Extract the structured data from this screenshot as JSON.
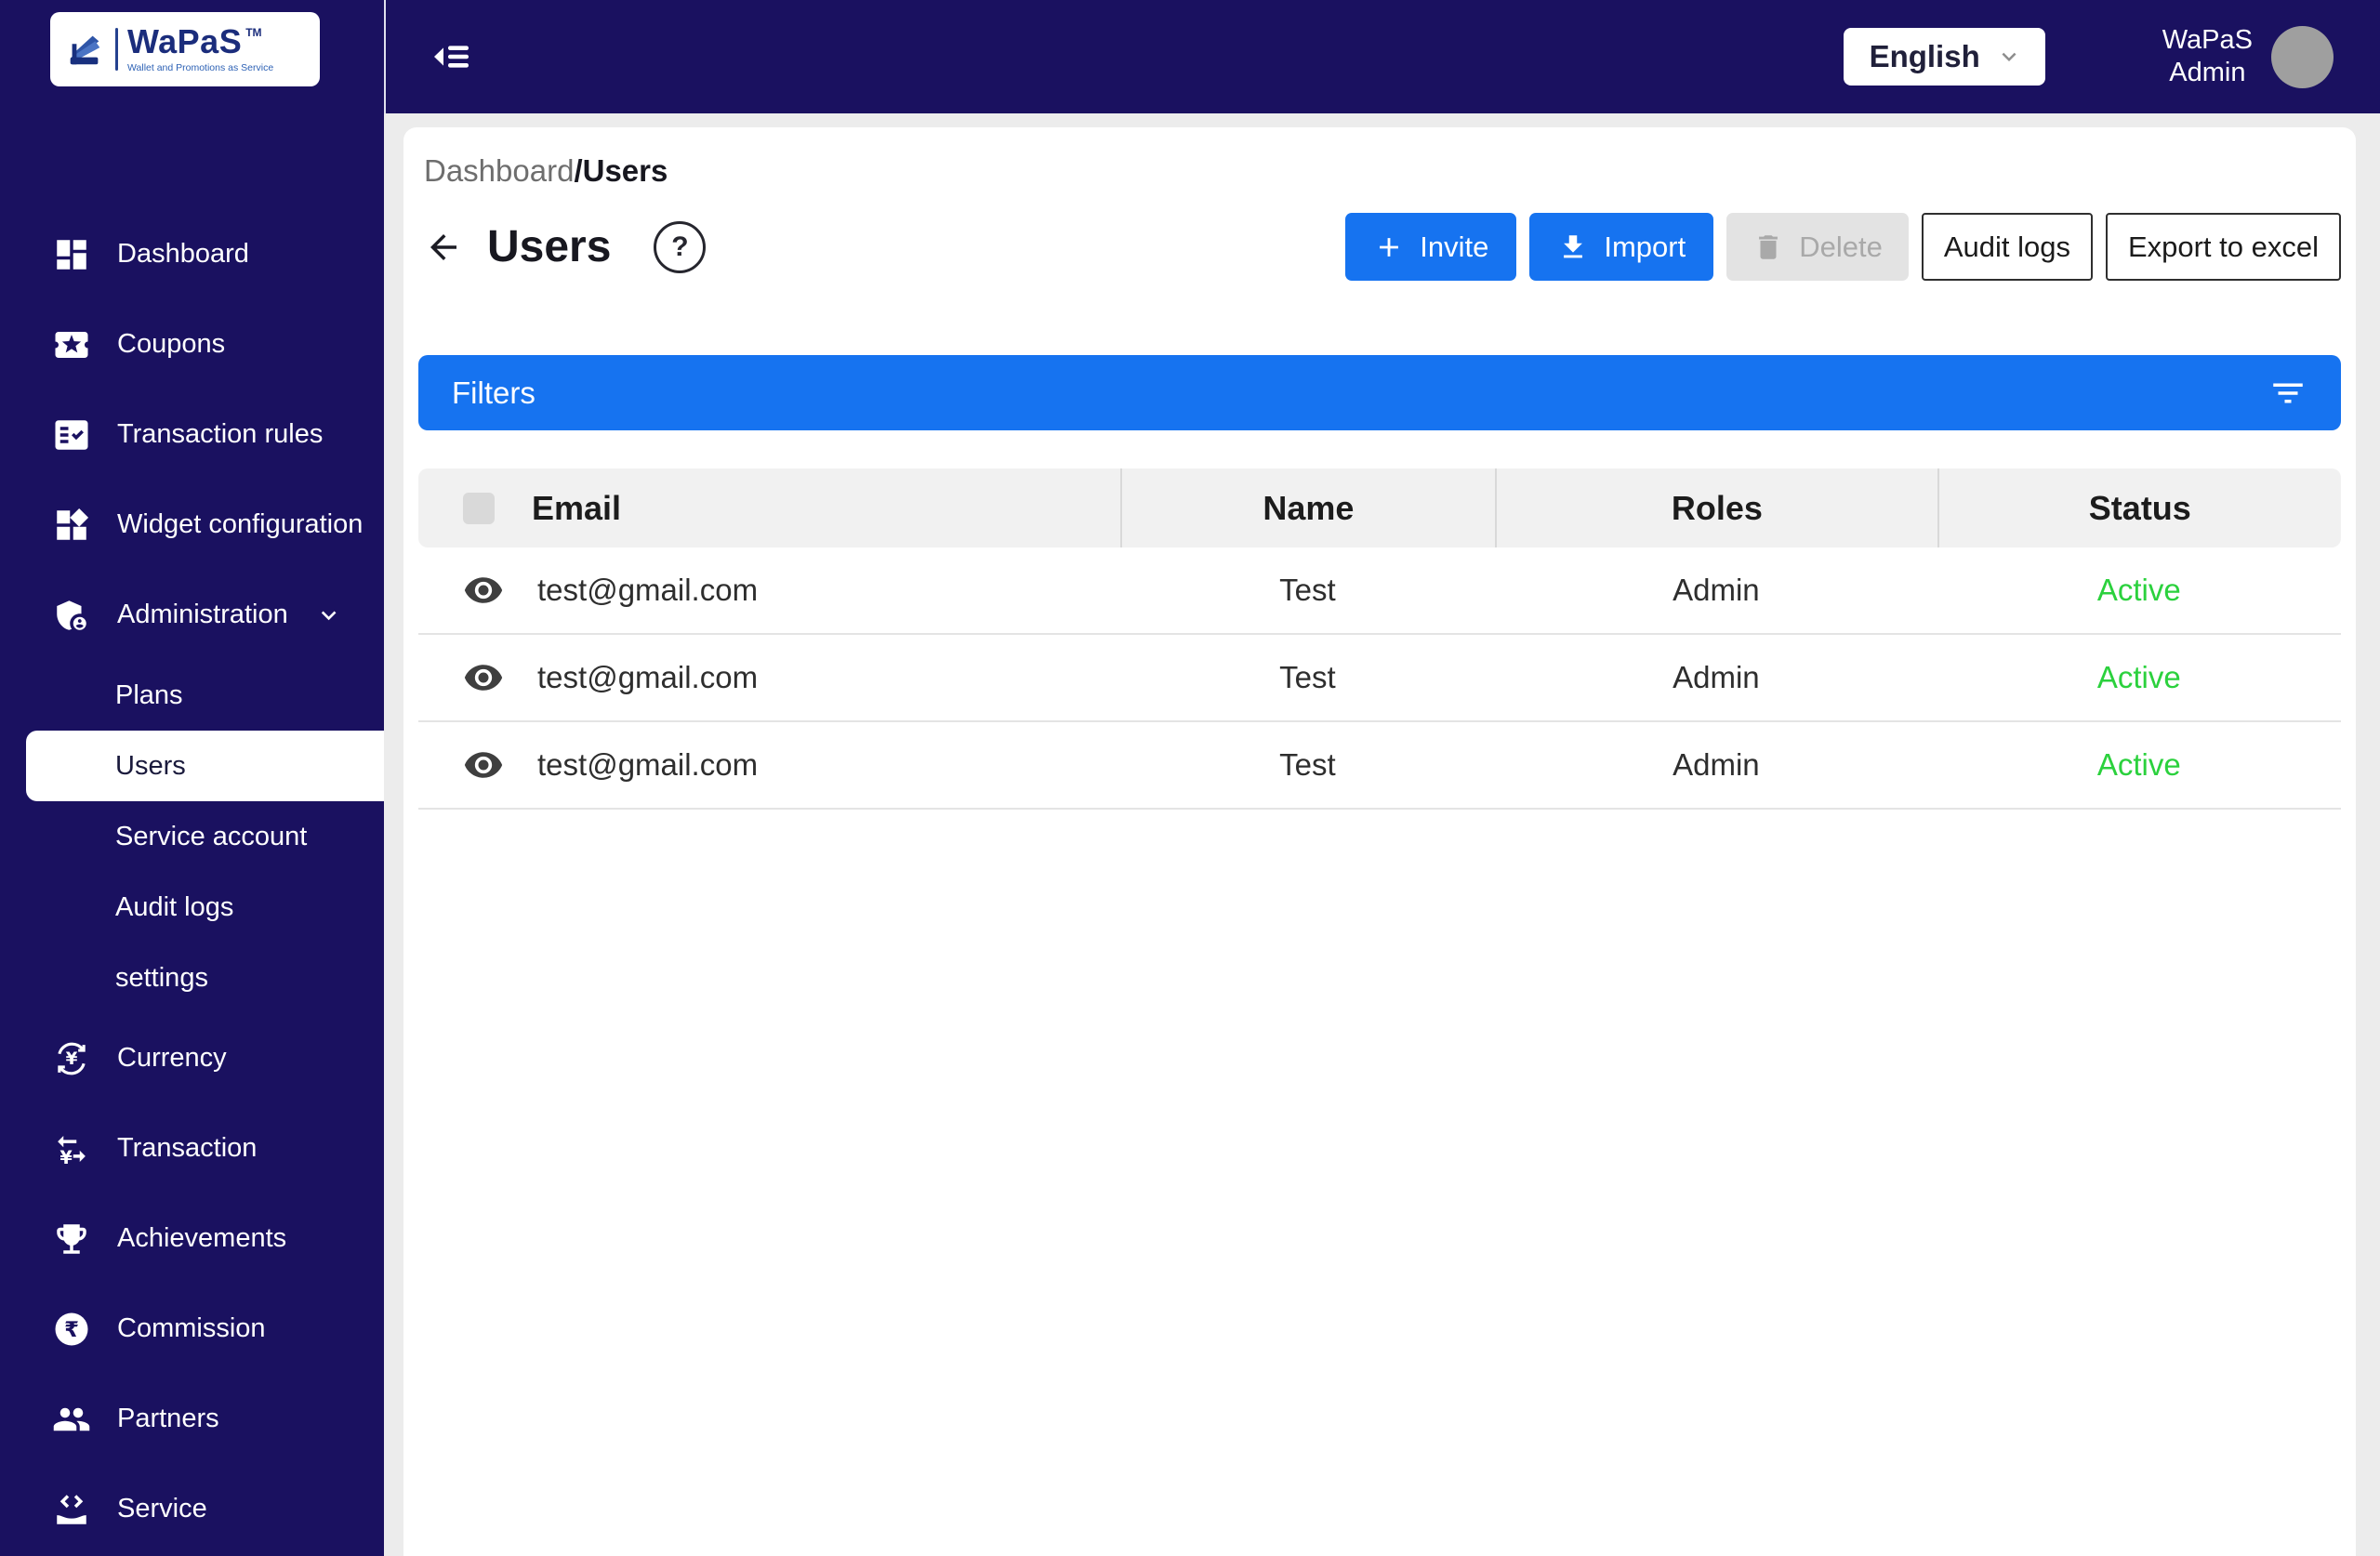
{
  "brand": {
    "name": "WaPaS",
    "tm": "TM",
    "tagline": "Wallet and Promotions as Service"
  },
  "topbar": {
    "language_selected": "English",
    "user_line1": "WaPaS",
    "user_line2": "Admin"
  },
  "sidebar": {
    "items": [
      {
        "label": "Dashboard"
      },
      {
        "label": "Coupons"
      },
      {
        "label": "Transaction rules"
      },
      {
        "label": "Widget configuration"
      },
      {
        "label": "Administration"
      },
      {
        "label": "Currency"
      },
      {
        "label": "Transaction"
      },
      {
        "label": "Achievements"
      },
      {
        "label": "Commission"
      },
      {
        "label": "Partners"
      },
      {
        "label": "Service"
      }
    ],
    "administration_children": [
      {
        "label": "Plans"
      },
      {
        "label": "Users"
      },
      {
        "label": "Service account"
      },
      {
        "label": "Audit logs"
      },
      {
        "label": "settings"
      }
    ]
  },
  "breadcrumb": {
    "parent": "Dashboard",
    "separator": "/",
    "current": "Users"
  },
  "page": {
    "title": "Users",
    "help_symbol": "?"
  },
  "toolbar": {
    "invite": "Invite",
    "import": "Import",
    "delete": "Delete",
    "audit_logs": "Audit logs",
    "export": "Export to excel"
  },
  "filters": {
    "label": "Filters"
  },
  "users_table": {
    "headers": {
      "email": "Email",
      "name": "Name",
      "roles": "Roles",
      "status": "Status"
    },
    "rows": [
      {
        "email": "test@gmail.com",
        "name": "Test",
        "roles": "Admin",
        "status": "Active"
      },
      {
        "email": "test@gmail.com",
        "name": "Test",
        "roles": "Admin",
        "status": "Active"
      },
      {
        "email": "test@gmail.com",
        "name": "Test",
        "roles": "Admin",
        "status": "Active"
      }
    ]
  },
  "colors": {
    "primary_blue": "#1673f0",
    "navy": "#1a1160",
    "active_green": "#2bd13d",
    "page_background": "#ececec"
  }
}
